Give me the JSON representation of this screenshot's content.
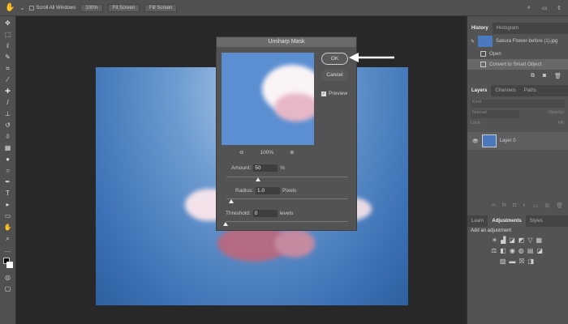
{
  "options_bar": {
    "scroll_all": "Scroll All Windows",
    "zoom": "100%",
    "fit_screen": "Fit Screen",
    "fill_screen": "Fill Screen"
  },
  "dialog": {
    "title": "Unsharp Mask",
    "ok": "OK",
    "cancel": "Cancel",
    "preview_label": "Preview",
    "preview_checked": true,
    "zoom": "100%",
    "amount_label": "Amount:",
    "amount_value": "50",
    "amount_unit": "%",
    "radius_label": "Radius:",
    "radius_value": "1.0",
    "radius_unit": "Pixels",
    "threshold_label": "Threshold:",
    "threshold_value": "0",
    "threshold_unit": "levels"
  },
  "history": {
    "tabs": [
      "History",
      "Histogram"
    ],
    "snapshot": "Sakura Flower-before (1).jpg",
    "items": [
      "Open",
      "Convert to Smart Object"
    ]
  },
  "layers": {
    "tabs": [
      "Layers",
      "Channels",
      "Paths"
    ],
    "kind": "Kind",
    "blend": "Normal",
    "opacity": "Opacity:",
    "lock": "Lock:",
    "fill": "Fill:",
    "layer_name": "Layer 0"
  },
  "adjustments": {
    "tabs": [
      "Learn",
      "Adjustments",
      "Styles"
    ],
    "heading": "Add an adjustment"
  }
}
